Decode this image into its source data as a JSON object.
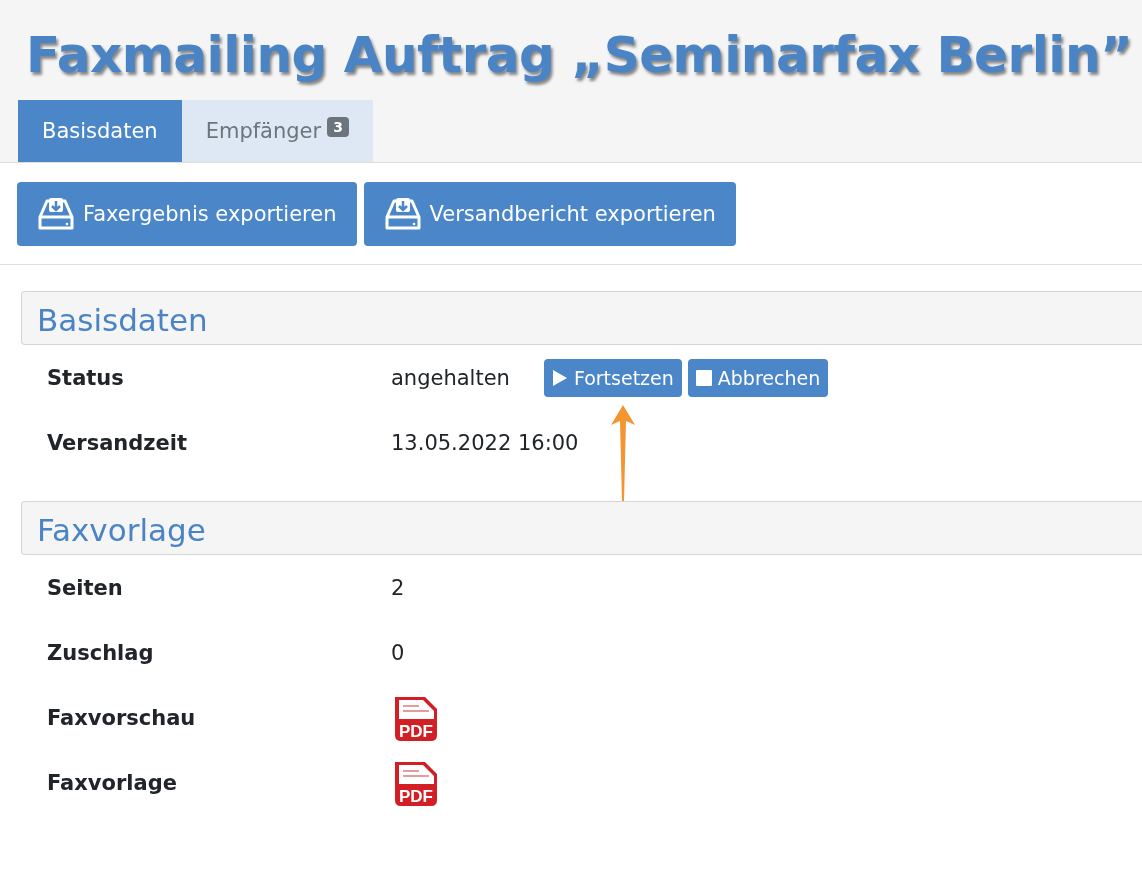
{
  "title": "Faxmailing Auftrag „Seminarfax Berlin”",
  "tabs": [
    {
      "label": "Basisdaten",
      "selected": true
    },
    {
      "label": "Empfänger",
      "badge": "3",
      "selected": false
    }
  ],
  "toolbar": [
    {
      "label": "Faxergebnis exportieren"
    },
    {
      "label": "Versandbericht exportieren"
    }
  ],
  "sections": [
    {
      "heading": "Basisdaten",
      "rows": [
        {
          "kind": "status",
          "label": "Status",
          "value": "angehalten",
          "actions": [
            {
              "kind": "play",
              "label": "Fortsetzen",
              "pointer": {
                "kind": "arrow"
              }
            },
            {
              "kind": "stop",
              "label": "Abbrechen"
            }
          ]
        },
        {
          "kind": "text",
          "label": "Versandzeit",
          "value": "13.05.2022 16:00"
        }
      ]
    },
    {
      "heading": "Faxvorlage",
      "rows": [
        {
          "kind": "text",
          "label": "Seiten",
          "value": "2"
        },
        {
          "kind": "text",
          "label": "Zuschlag",
          "value": "0"
        },
        {
          "kind": "pdf",
          "label": "Faxvorschau",
          "icon_label": "PDF"
        },
        {
          "kind": "pdf",
          "label": "Faxvorlage",
          "icon_label": "PDF"
        }
      ]
    }
  ]
}
